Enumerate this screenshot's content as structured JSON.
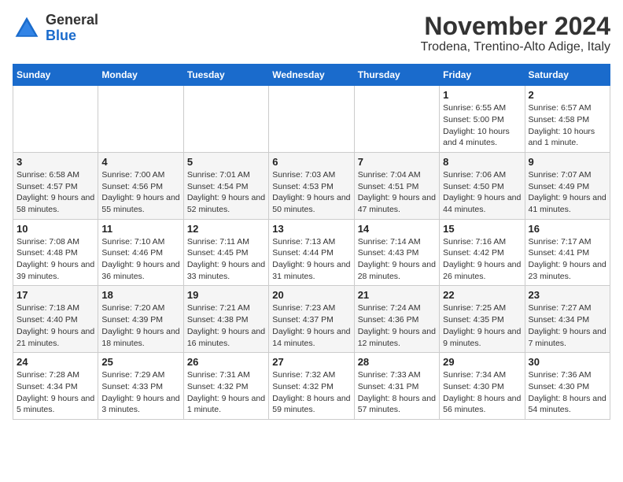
{
  "header": {
    "logo_general": "General",
    "logo_blue": "Blue",
    "month_title": "November 2024",
    "location": "Trodena, Trentino-Alto Adige, Italy"
  },
  "weekdays": [
    "Sunday",
    "Monday",
    "Tuesday",
    "Wednesday",
    "Thursday",
    "Friday",
    "Saturday"
  ],
  "weeks": [
    [
      {
        "day": "",
        "info": ""
      },
      {
        "day": "",
        "info": ""
      },
      {
        "day": "",
        "info": ""
      },
      {
        "day": "",
        "info": ""
      },
      {
        "day": "",
        "info": ""
      },
      {
        "day": "1",
        "info": "Sunrise: 6:55 AM\nSunset: 5:00 PM\nDaylight: 10 hours and 4 minutes."
      },
      {
        "day": "2",
        "info": "Sunrise: 6:57 AM\nSunset: 4:58 PM\nDaylight: 10 hours and 1 minute."
      }
    ],
    [
      {
        "day": "3",
        "info": "Sunrise: 6:58 AM\nSunset: 4:57 PM\nDaylight: 9 hours and 58 minutes."
      },
      {
        "day": "4",
        "info": "Sunrise: 7:00 AM\nSunset: 4:56 PM\nDaylight: 9 hours and 55 minutes."
      },
      {
        "day": "5",
        "info": "Sunrise: 7:01 AM\nSunset: 4:54 PM\nDaylight: 9 hours and 52 minutes."
      },
      {
        "day": "6",
        "info": "Sunrise: 7:03 AM\nSunset: 4:53 PM\nDaylight: 9 hours and 50 minutes."
      },
      {
        "day": "7",
        "info": "Sunrise: 7:04 AM\nSunset: 4:51 PM\nDaylight: 9 hours and 47 minutes."
      },
      {
        "day": "8",
        "info": "Sunrise: 7:06 AM\nSunset: 4:50 PM\nDaylight: 9 hours and 44 minutes."
      },
      {
        "day": "9",
        "info": "Sunrise: 7:07 AM\nSunset: 4:49 PM\nDaylight: 9 hours and 41 minutes."
      }
    ],
    [
      {
        "day": "10",
        "info": "Sunrise: 7:08 AM\nSunset: 4:48 PM\nDaylight: 9 hours and 39 minutes."
      },
      {
        "day": "11",
        "info": "Sunrise: 7:10 AM\nSunset: 4:46 PM\nDaylight: 9 hours and 36 minutes."
      },
      {
        "day": "12",
        "info": "Sunrise: 7:11 AM\nSunset: 4:45 PM\nDaylight: 9 hours and 33 minutes."
      },
      {
        "day": "13",
        "info": "Sunrise: 7:13 AM\nSunset: 4:44 PM\nDaylight: 9 hours and 31 minutes."
      },
      {
        "day": "14",
        "info": "Sunrise: 7:14 AM\nSunset: 4:43 PM\nDaylight: 9 hours and 28 minutes."
      },
      {
        "day": "15",
        "info": "Sunrise: 7:16 AM\nSunset: 4:42 PM\nDaylight: 9 hours and 26 minutes."
      },
      {
        "day": "16",
        "info": "Sunrise: 7:17 AM\nSunset: 4:41 PM\nDaylight: 9 hours and 23 minutes."
      }
    ],
    [
      {
        "day": "17",
        "info": "Sunrise: 7:18 AM\nSunset: 4:40 PM\nDaylight: 9 hours and 21 minutes."
      },
      {
        "day": "18",
        "info": "Sunrise: 7:20 AM\nSunset: 4:39 PM\nDaylight: 9 hours and 18 minutes."
      },
      {
        "day": "19",
        "info": "Sunrise: 7:21 AM\nSunset: 4:38 PM\nDaylight: 9 hours and 16 minutes."
      },
      {
        "day": "20",
        "info": "Sunrise: 7:23 AM\nSunset: 4:37 PM\nDaylight: 9 hours and 14 minutes."
      },
      {
        "day": "21",
        "info": "Sunrise: 7:24 AM\nSunset: 4:36 PM\nDaylight: 9 hours and 12 minutes."
      },
      {
        "day": "22",
        "info": "Sunrise: 7:25 AM\nSunset: 4:35 PM\nDaylight: 9 hours and 9 minutes."
      },
      {
        "day": "23",
        "info": "Sunrise: 7:27 AM\nSunset: 4:34 PM\nDaylight: 9 hours and 7 minutes."
      }
    ],
    [
      {
        "day": "24",
        "info": "Sunrise: 7:28 AM\nSunset: 4:34 PM\nDaylight: 9 hours and 5 minutes."
      },
      {
        "day": "25",
        "info": "Sunrise: 7:29 AM\nSunset: 4:33 PM\nDaylight: 9 hours and 3 minutes."
      },
      {
        "day": "26",
        "info": "Sunrise: 7:31 AM\nSunset: 4:32 PM\nDaylight: 9 hours and 1 minute."
      },
      {
        "day": "27",
        "info": "Sunrise: 7:32 AM\nSunset: 4:32 PM\nDaylight: 8 hours and 59 minutes."
      },
      {
        "day": "28",
        "info": "Sunrise: 7:33 AM\nSunset: 4:31 PM\nDaylight: 8 hours and 57 minutes."
      },
      {
        "day": "29",
        "info": "Sunrise: 7:34 AM\nSunset: 4:30 PM\nDaylight: 8 hours and 56 minutes."
      },
      {
        "day": "30",
        "info": "Sunrise: 7:36 AM\nSunset: 4:30 PM\nDaylight: 8 hours and 54 minutes."
      }
    ]
  ]
}
